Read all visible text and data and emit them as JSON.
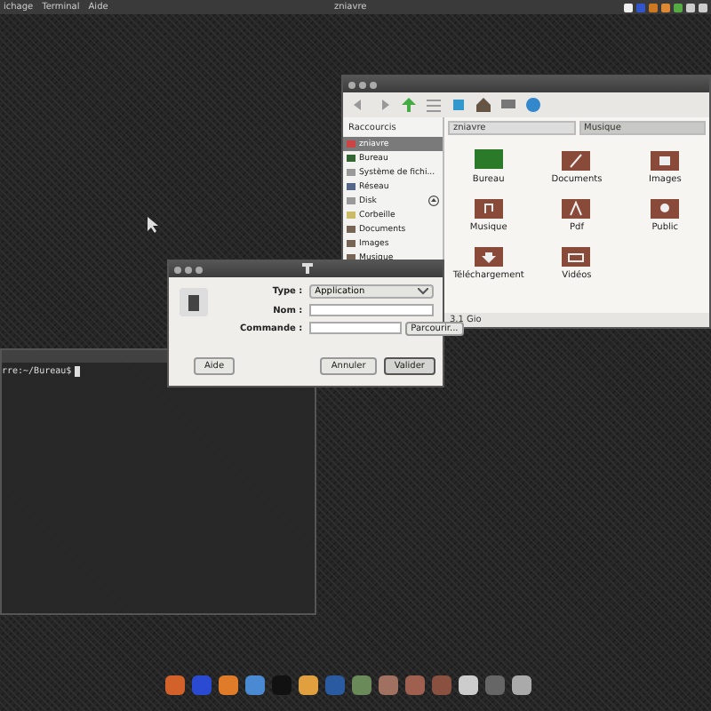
{
  "top_panel": {
    "menus": [
      "ichage",
      "Terminal",
      "Aide"
    ],
    "title": "zniavre"
  },
  "file_manager": {
    "sidebar": {
      "header": "Raccourcis",
      "items": [
        {
          "label": "zniavre",
          "kind": "home",
          "selected": true,
          "ejectable": false
        },
        {
          "label": "Bureau",
          "kind": "desktop",
          "selected": false,
          "ejectable": false
        },
        {
          "label": "Système de fichi...",
          "kind": "drive",
          "selected": false,
          "ejectable": false
        },
        {
          "label": "Réseau",
          "kind": "network",
          "selected": false,
          "ejectable": false
        },
        {
          "label": "Disk",
          "kind": "drive",
          "selected": false,
          "ejectable": true
        },
        {
          "label": "Corbeille",
          "kind": "trash",
          "selected": false,
          "ejectable": false
        },
        {
          "label": "Documents",
          "kind": "folder",
          "selected": false,
          "ejectable": false
        },
        {
          "label": "Images",
          "kind": "folder",
          "selected": false,
          "ejectable": false
        },
        {
          "label": "Musique",
          "kind": "folder",
          "selected": false,
          "ejectable": false
        }
      ]
    },
    "path": [
      {
        "label": "zniavre",
        "selected": false
      },
      {
        "label": "Musique",
        "selected": true
      }
    ],
    "folders": [
      {
        "label": "Bureau",
        "kind": "desktop"
      },
      {
        "label": "Documents",
        "kind": "documents"
      },
      {
        "label": "Images",
        "kind": "images"
      },
      {
        "label": "Musique",
        "kind": "music"
      },
      {
        "label": "Pdf",
        "kind": "pdf"
      },
      {
        "label": "Public",
        "kind": "public"
      },
      {
        "label": "Téléchargement",
        "kind": "download"
      },
      {
        "label": "Vidéos",
        "kind": "videos"
      }
    ],
    "status_bar": "3,1 Gio"
  },
  "dialog": {
    "fields": [
      {
        "label": "Type :",
        "kind": "dropdown",
        "value": "Application"
      },
      {
        "label": "Nom :",
        "kind": "text"
      },
      {
        "label": "Commande :",
        "kind": "browse",
        "button": "Parcourir..."
      }
    ],
    "buttons": [
      {
        "label": "Aide",
        "selected": false
      },
      {
        "label": "Annuler",
        "selected": false
      },
      {
        "label": "Valider",
        "selected": true
      }
    ]
  },
  "terminal": {
    "prompt": "rre:~/Bureau$"
  }
}
